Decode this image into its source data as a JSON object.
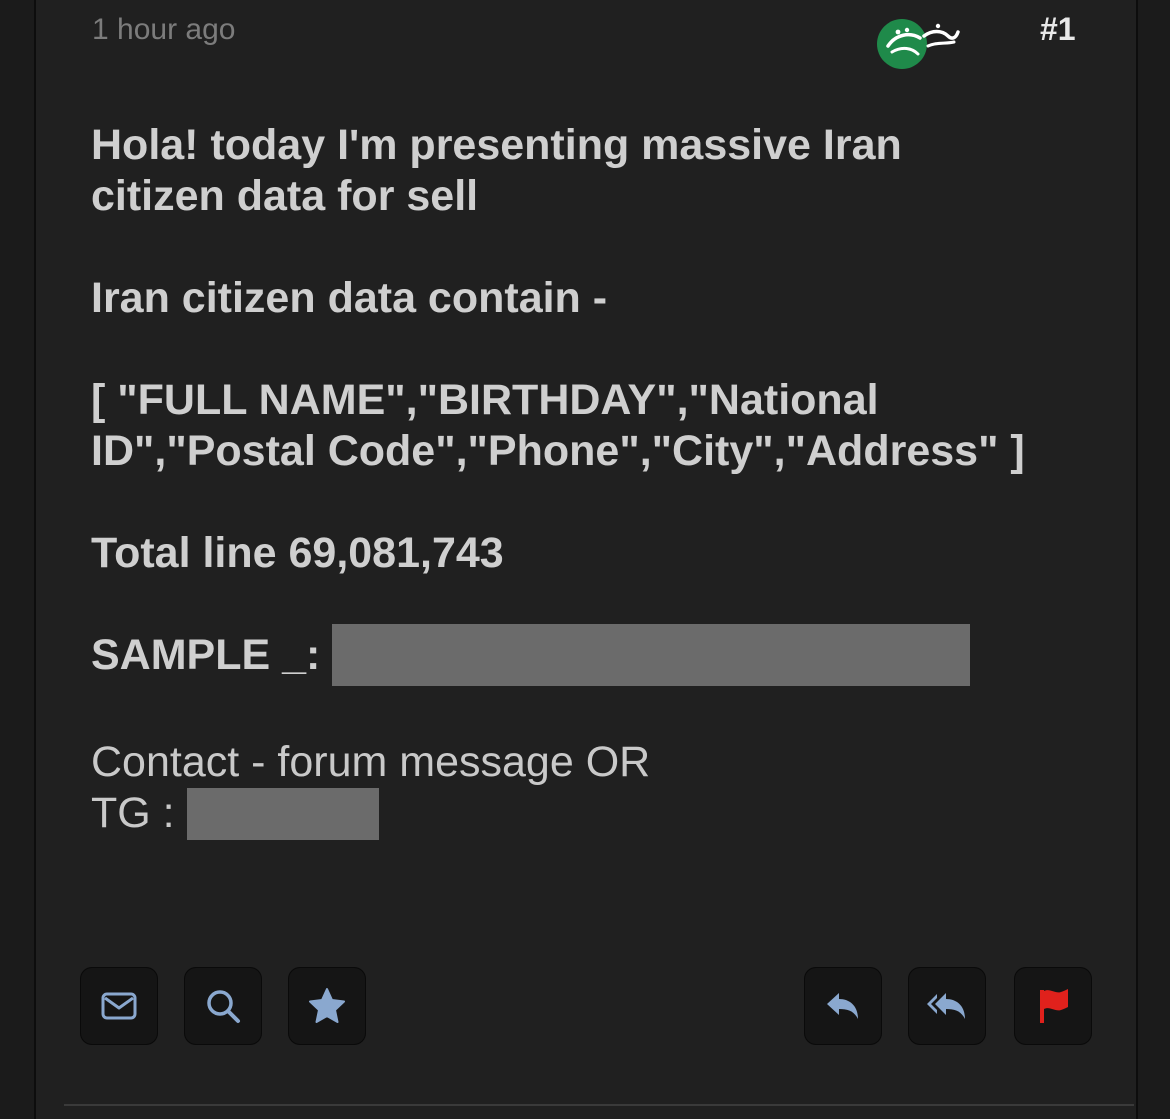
{
  "post": {
    "timestamp": "1 hour ago",
    "number": "#1",
    "watermark_text": "خبرفوری",
    "lines": {
      "intro_line1": "Hola! today I'm presenting massive Iran",
      "intro_line2": "citizen data for sell",
      "contains": "Iran citizen data contain -",
      "fields_line1": "[ \"FULL NAME\",\"BIRTHDAY\",\"National",
      "fields_line2": "ID\",\"Postal Code\",\"Phone\",\"City\",\"Address\" ]",
      "total": "Total line 69,081,743",
      "sample_label": "SAMPLE _:",
      "contact_line1": "Contact - forum message OR",
      "contact_label": "TG :"
    }
  },
  "actions": {
    "left": [
      {
        "icon": "envelope-icon"
      },
      {
        "icon": "search-icon"
      },
      {
        "icon": "star-icon"
      }
    ],
    "right": [
      {
        "icon": "reply-icon"
      },
      {
        "icon": "reply-all-icon"
      },
      {
        "icon": "flag-icon"
      }
    ]
  },
  "colors": {
    "background": "#202020",
    "text": "#cfcfcf",
    "muted": "#7c7c7c",
    "icon": "#8aa8cf",
    "flag": "#e0211c",
    "redaction": "#6b6b6b",
    "logo_green": "#1f8a4a"
  }
}
